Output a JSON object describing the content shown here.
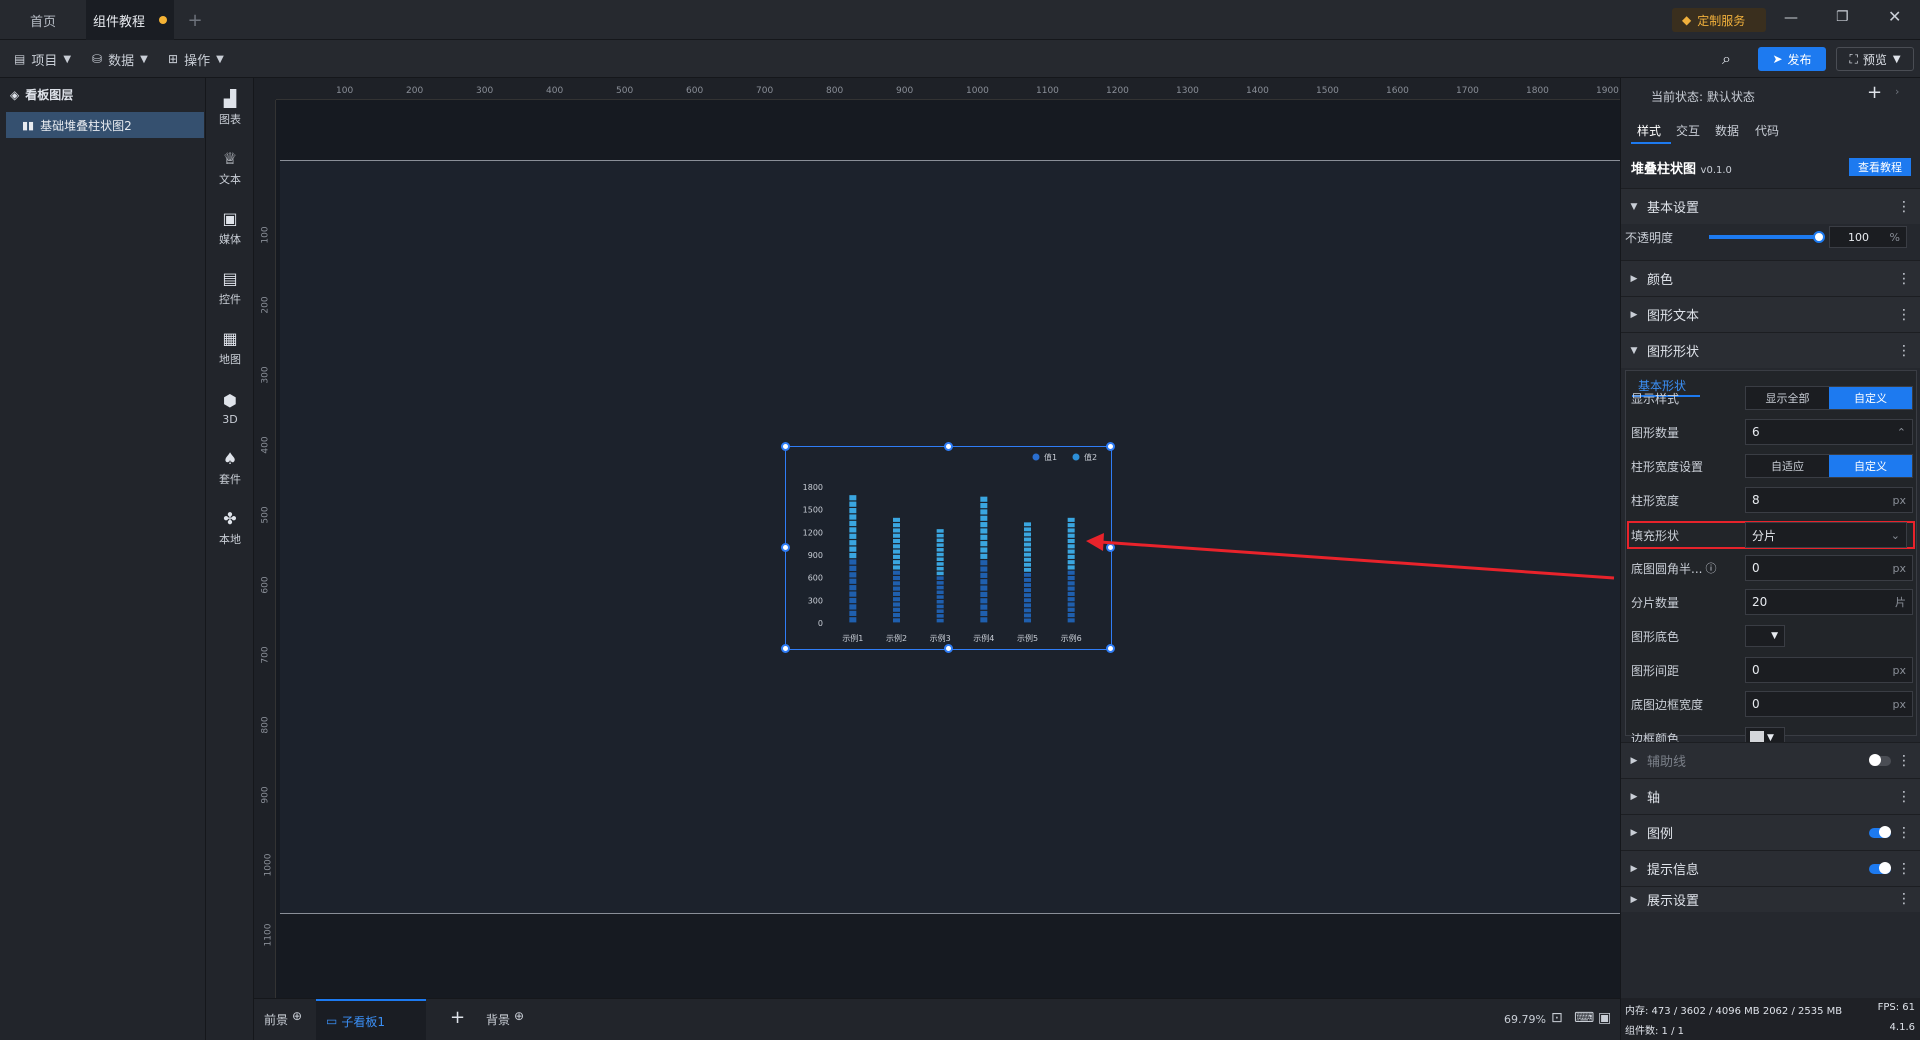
{
  "tabs": {
    "home": "首页",
    "tutorial": "组件教程"
  },
  "custom_service": "定制服务",
  "toolbar": {
    "project": "项目",
    "data": "数据",
    "ops": "操作",
    "publish": "发布",
    "preview": "预览"
  },
  "layers": {
    "title": "看板图层",
    "item": "基础堆叠柱状图2"
  },
  "icons": [
    {
      "label": "图表",
      "glyph": "▟"
    },
    {
      "label": "文本",
      "glyph": "♕"
    },
    {
      "label": "媒体",
      "glyph": "▣"
    },
    {
      "label": "控件",
      "glyph": "▤"
    },
    {
      "label": "地图",
      "glyph": "▦"
    },
    {
      "label": "3D",
      "glyph": "⬢"
    },
    {
      "label": "套件",
      "glyph": "♠"
    },
    {
      "label": "本地",
      "glyph": "✤"
    }
  ],
  "ruler": {
    "top": [
      "100",
      "200",
      "300",
      "400",
      "500",
      "600",
      "700",
      "800",
      "900",
      "1000",
      "1100",
      "1200",
      "1300",
      "1400",
      "1500",
      "1600",
      "1700",
      "1800",
      "1900"
    ],
    "left": [
      "100",
      "200",
      "300",
      "400",
      "500",
      "600",
      "700",
      "800",
      "900",
      "1000",
      "1100"
    ]
  },
  "chart_data": {
    "type": "bar",
    "categories": [
      "示例1",
      "示例2",
      "示例3",
      "示例4",
      "示例5",
      "示例6"
    ],
    "series": [
      {
        "name": "值1",
        "values": [
          1700,
          1400,
          1250,
          1680,
          1340,
          1400
        ]
      },
      {
        "name": "值2",
        "values": [
          0,
          0,
          0,
          0,
          0,
          0
        ]
      }
    ],
    "ylim": [
      0,
      1800
    ],
    "yticks": [
      "0",
      "300",
      "600",
      "900",
      "1200",
      "1500",
      "1800"
    ],
    "legend": "top-right"
  },
  "bottom": {
    "front": "前景",
    "sub": "子看板1",
    "back": "背景",
    "zoom": "69.79%"
  },
  "status": {
    "memory": "内存: 473 / 3602 / 4096 MB 2062 / 2535 MB",
    "fps": "FPS: 61",
    "components": "组件数: 1 / 1",
    "version": "4.1.6"
  },
  "right": {
    "state": "当前状态: 默认状态",
    "tabs": [
      "样式",
      "交互",
      "数据",
      "代码"
    ],
    "comp_name": "堆叠柱状图",
    "comp_ver": "v0.1.0",
    "tutorial_btn": "查看教程",
    "basic": "基本设置",
    "opacity_label": "不透明度",
    "opacity_value": "100",
    "opacity_unit": "%",
    "opacity_level": 0.98,
    "color": "颜色",
    "shape_text": "图形文本",
    "shape": "图形形状",
    "basic_shape_tab": "基本形状",
    "display_style": "显示样式",
    "show_all": "显示全部",
    "custom": "自定义",
    "shape_count_label": "图形数量",
    "shape_count": "6",
    "bar_width_setting": "柱形宽度设置",
    "adaptive": "自适应",
    "bar_width_label": "柱形宽度",
    "bar_width": "8",
    "px": "px",
    "fill_shape_label": "填充形状",
    "fill_shape": "分片",
    "radius_label": "底图圆角半...",
    "radius": "0",
    "slice_count_label": "分片数量",
    "slice_count": "20",
    "slice_unit": "片",
    "base_color_label": "图形底色",
    "spacing_label": "图形间距",
    "spacing": "0",
    "border_width_label": "底图边框宽度",
    "border_width": "0",
    "border_color_label": "边框颜色",
    "aux": "辅助线",
    "axis": "轴",
    "legend": "图例",
    "tooltip": "提示信息",
    "display": "展示设置"
  }
}
